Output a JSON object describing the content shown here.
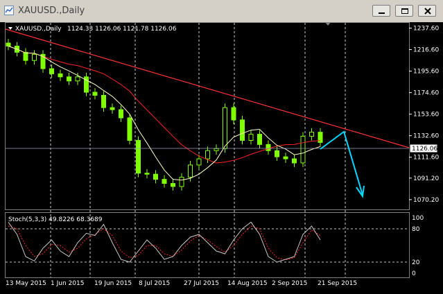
{
  "window": {
    "title": "XAUUSD.,Daily",
    "buttons": [
      "minimize",
      "restore",
      "close"
    ]
  },
  "header": {
    "symbol": "XAUUSD.,Daily",
    "ohlc": "1124.33 1126.06 1121.78 1126.06"
  },
  "price_axis": {
    "ticks": [
      "1237.60",
      "1216.60",
      "1195.60",
      "1174.60",
      "1153.60",
      "1132.60",
      "1111.60",
      "1091.20",
      "1070.20"
    ],
    "current_price_label": "1126.06"
  },
  "indicator": {
    "label": "Stoch(5,3,3) 49.8226 68.3689",
    "levels": [
      "100",
      "80",
      "20",
      "0"
    ]
  },
  "date_axis": {
    "labels": [
      "13 May 2015",
      "1 Jun 2015",
      "19 Jun 2015",
      "8 Jul 2015",
      "27 Jul 2015",
      "14 Aug 2015",
      "2 Sep 2015",
      "21 Sep 2015"
    ]
  },
  "colors": {
    "background": "#000000",
    "bull_candle": "#7fff00",
    "ma_fast": "#ffffc0",
    "ma_slow": "#ff2020",
    "trendline": "#ff3030",
    "projection": "#00d8ff",
    "stoch_main": "#c8c8c8",
    "stoch_signal": "#ff2020",
    "grid": "#ffffff"
  },
  "chart_data": {
    "type": "candlestick",
    "title": "XAUUSD.,Daily",
    "ylim": [
      1062,
      1242
    ],
    "x": [
      "13 May 2015",
      "1 Jun 2015",
      "19 Jun 2015",
      "8 Jul 2015",
      "27 Jul 2015",
      "14 Aug 2015",
      "2 Sep 2015",
      "21 Sep 2015"
    ],
    "close_approx": [
      1220,
      1214,
      1206,
      1212,
      1198,
      1193,
      1190,
      1186,
      1190,
      1175,
      1172,
      1160,
      1158,
      1150,
      1128,
      1096,
      1095,
      1090,
      1086,
      1083,
      1092,
      1104,
      1110,
      1118,
      1120,
      1160,
      1148,
      1128,
      1134,
      1124,
      1118,
      1112,
      1110,
      1106,
      1132,
      1136,
      1126
    ],
    "last_close": 1126.06,
    "stoch_main": [
      92,
      70,
      30,
      22,
      45,
      60,
      40,
      30,
      55,
      72,
      68,
      88,
      55,
      25,
      20,
      40,
      60,
      45,
      25,
      30,
      50,
      65,
      70,
      55,
      40,
      35,
      60,
      80,
      92,
      70,
      30,
      20,
      25,
      30,
      70,
      85,
      60
    ],
    "stoch_signal": [
      85,
      80,
      50,
      30,
      35,
      52,
      50,
      38,
      45,
      62,
      70,
      80,
      68,
      40,
      28,
      32,
      50,
      50,
      35,
      30,
      42,
      58,
      68,
      60,
      48,
      38,
      50,
      70,
      85,
      80,
      45,
      28,
      24,
      28,
      55,
      78,
      68
    ]
  }
}
